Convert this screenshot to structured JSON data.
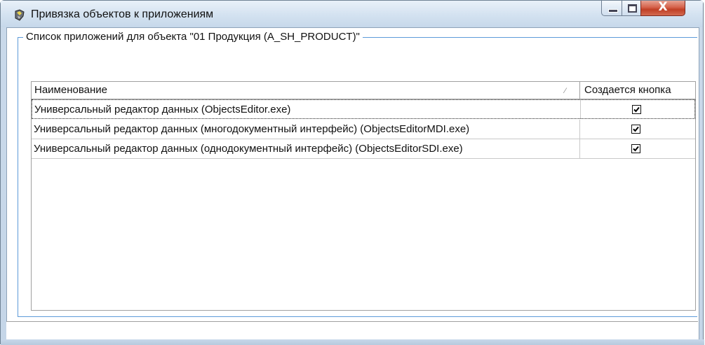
{
  "window": {
    "title": "Привязка объектов к приложениям",
    "close_glyph": "X"
  },
  "group": {
    "label": "Список приложений для объекта \"01 Продукция (A_SH_PRODUCT)\""
  },
  "grid": {
    "columns": [
      "Наименование",
      "Создается кнопка"
    ],
    "rows": [
      {
        "name": "Универсальный редактор данных (ObjectsEditor.exe)",
        "checked": true
      },
      {
        "name": "Универсальный редактор данных (многодокументный интерфейс) (ObjectsEditorMDI.exe)",
        "checked": true
      },
      {
        "name": "Универсальный редактор данных (однодокументный интерфейс) (ObjectsEditorSDI.exe)",
        "checked": true
      }
    ]
  },
  "icons": {
    "app": "app-icon",
    "sort": "sort-icon",
    "minimize": "minimize-icon",
    "maximize": "maximize-icon",
    "close": "close-icon",
    "check": "checkmark-icon"
  }
}
